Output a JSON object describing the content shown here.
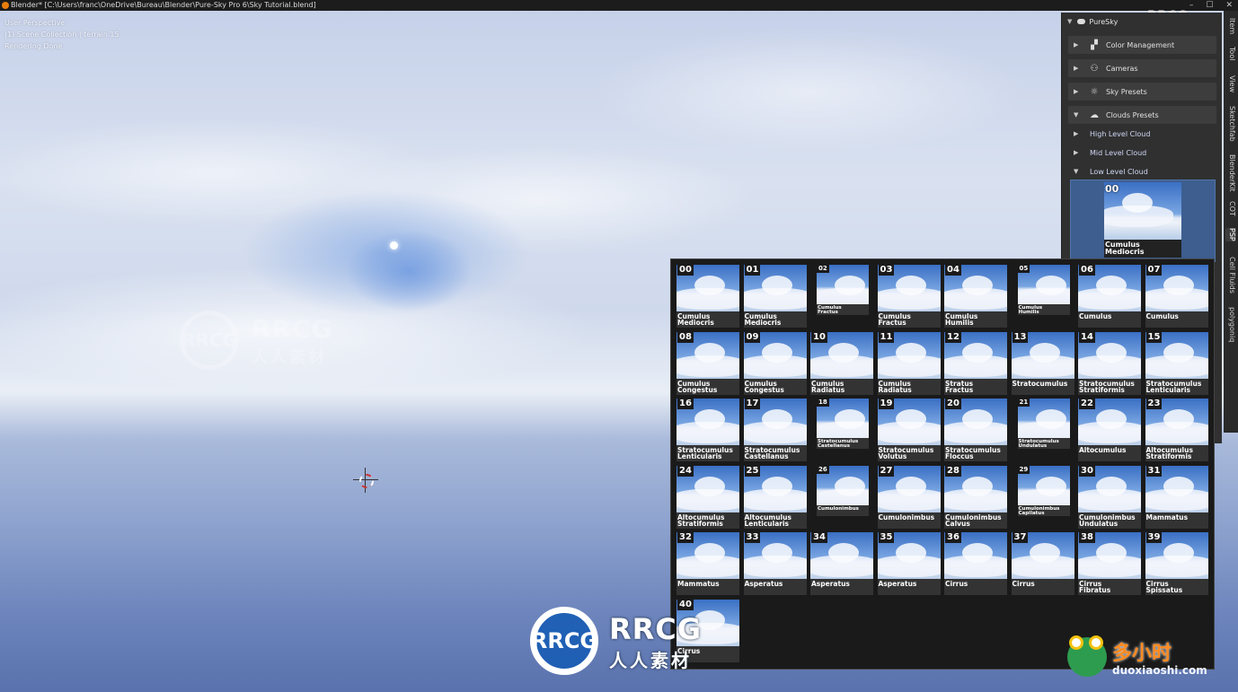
{
  "window": {
    "title": "Blender* [C:\\Users\\franc\\OneDrive\\Bureau\\Blender\\Pure-Sky Pro 6\\Sky Tutorial.blend]",
    "controls": [
      "–",
      "☐",
      "✕"
    ]
  },
  "viewport": {
    "info": [
      "User Perspective",
      "(1) Scene Collection | terrain 15",
      "Rendering Done"
    ]
  },
  "watermarks": {
    "rrcg_logo": "RRCG",
    "rrcg_line1": "RRCG",
    "rrcg_line2": "人人素材",
    "corner": "RRCG.cn",
    "dxs_line1": "多小时",
    "dxs_line2": "duoxiaoshi.com"
  },
  "panel": {
    "title": "PureSky",
    "sections": [
      {
        "label": "Color Management",
        "icon": "color-management-icon",
        "glyph": "▞",
        "expanded": false
      },
      {
        "label": "Cameras",
        "icon": "camera-icon",
        "glyph": "⚇",
        "expanded": false
      },
      {
        "label": "Sky Presets",
        "icon": "sun-icon",
        "glyph": "☼",
        "expanded": false
      },
      {
        "label": "Clouds Presets",
        "icon": "cloud-icon",
        "glyph": "☁",
        "expanded": true
      }
    ],
    "subsections": [
      {
        "label": "High Level Cloud",
        "expanded": false
      },
      {
        "label": "Mid Level Cloud",
        "expanded": false
      },
      {
        "label": "Low Level Cloud",
        "expanded": true
      }
    ],
    "preview": {
      "number": "00",
      "name_line1": "Cumulus",
      "name_line2": "Mediocris"
    }
  },
  "vertical_tabs": [
    "Item",
    "Tool",
    "View",
    "Sketchfab",
    "BlenderKit",
    "COT",
    "PSP",
    "Cell Fluids",
    "polygoniq"
  ],
  "active_tab": "PSP",
  "presets": [
    {
      "num": "00",
      "l1": "Cumulus",
      "l2": "Mediocris",
      "small": false
    },
    {
      "num": "01",
      "l1": "Cumulus",
      "l2": "Mediocris",
      "small": false
    },
    {
      "num": "02",
      "l1": "Cumulus",
      "l2": "Fractus",
      "small": true
    },
    {
      "num": "03",
      "l1": "Cumulus",
      "l2": "Fractus",
      "small": false
    },
    {
      "num": "04",
      "l1": "Cumulus",
      "l2": "Humilis",
      "small": false
    },
    {
      "num": "05",
      "l1": "Cumulus",
      "l2": "Humilis",
      "small": true
    },
    {
      "num": "06",
      "l1": "Cumulus",
      "l2": "",
      "small": false
    },
    {
      "num": "07",
      "l1": "Cumulus",
      "l2": "",
      "small": false
    },
    {
      "num": "08",
      "l1": "Cumulus",
      "l2": "Congestus",
      "small": false
    },
    {
      "num": "09",
      "l1": "Cumulus",
      "l2": "Congestus",
      "small": false
    },
    {
      "num": "10",
      "l1": "Cumulus",
      "l2": "Radiatus",
      "small": false
    },
    {
      "num": "11",
      "l1": "Cumulus",
      "l2": "Radiatus",
      "small": false
    },
    {
      "num": "12",
      "l1": "Stratus",
      "l2": "Fractus",
      "small": false
    },
    {
      "num": "13",
      "l1": "Stratocumulus",
      "l2": "",
      "small": false
    },
    {
      "num": "14",
      "l1": "Stratocumulus",
      "l2": "Stratiformis",
      "small": false
    },
    {
      "num": "15",
      "l1": "Stratocumulus",
      "l2": "Lenticularis",
      "small": false
    },
    {
      "num": "16",
      "l1": "Stratocumulus",
      "l2": "Lenticularis",
      "small": false
    },
    {
      "num": "17",
      "l1": "Stratocumulus",
      "l2": "Castellanus",
      "small": false
    },
    {
      "num": "18",
      "l1": "Stratocumulus",
      "l2": "Castellanus",
      "small": true
    },
    {
      "num": "19",
      "l1": "Stratocumulus",
      "l2": "Volutus",
      "small": false
    },
    {
      "num": "20",
      "l1": "Stratocumulus",
      "l2": "Floccus",
      "small": false
    },
    {
      "num": "21",
      "l1": "Stratocumulus",
      "l2": "Undulatus",
      "small": true
    },
    {
      "num": "22",
      "l1": "Altocumulus",
      "l2": "",
      "small": false
    },
    {
      "num": "23",
      "l1": "Altocumulus",
      "l2": "Stratiformis",
      "small": false
    },
    {
      "num": "24",
      "l1": "Altocumulus",
      "l2": "Stratiformis",
      "small": false
    },
    {
      "num": "25",
      "l1": "Altocumulus",
      "l2": "Lenticularis",
      "small": false
    },
    {
      "num": "26",
      "l1": "Cumulonimbus",
      "l2": "",
      "small": true
    },
    {
      "num": "27",
      "l1": "Cumulonimbus",
      "l2": "",
      "small": false
    },
    {
      "num": "28",
      "l1": "Cumulonimbus",
      "l2": "Calvus",
      "small": false
    },
    {
      "num": "29",
      "l1": "Cumulonimbus",
      "l2": "Capilatus",
      "small": true
    },
    {
      "num": "30",
      "l1": "Cumulonimbus",
      "l2": "Undulatus",
      "small": false
    },
    {
      "num": "31",
      "l1": "Mammatus",
      "l2": "",
      "small": false
    },
    {
      "num": "32",
      "l1": "Mammatus",
      "l2": "",
      "small": false
    },
    {
      "num": "33",
      "l1": "Asperatus",
      "l2": "",
      "small": false
    },
    {
      "num": "34",
      "l1": "Asperatus",
      "l2": "",
      "small": false
    },
    {
      "num": "35",
      "l1": "Asperatus",
      "l2": "",
      "small": false
    },
    {
      "num": "36",
      "l1": "Cirrus",
      "l2": "",
      "small": false
    },
    {
      "num": "37",
      "l1": "Cirrus",
      "l2": "",
      "small": false
    },
    {
      "num": "38",
      "l1": "Cirrus",
      "l2": "Fibratus",
      "small": false
    },
    {
      "num": "39",
      "l1": "Cirrus",
      "l2": "Spissatus",
      "small": false
    },
    {
      "num": "40",
      "l1": "Cirrus",
      "l2": "",
      "small": false
    }
  ]
}
